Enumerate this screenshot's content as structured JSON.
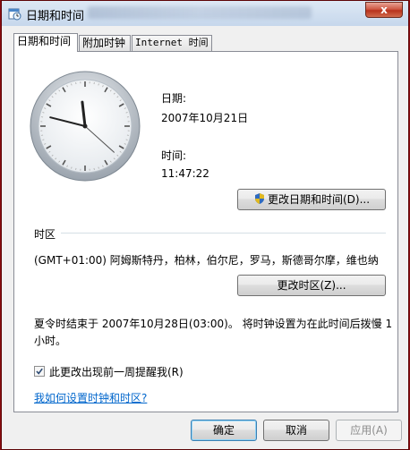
{
  "window": {
    "title": "日期和时间",
    "close_label": "x"
  },
  "tabs": [
    {
      "label": "日期和时间"
    },
    {
      "label": "附加时钟"
    },
    {
      "label": "Internet 时间"
    }
  ],
  "datetime": {
    "date_label": "日期:",
    "date_value": "2007年10月21日",
    "time_label": "时间:",
    "time_value": "11:47:22",
    "change_datetime_button": "更改日期和时间(D)..."
  },
  "clock": {
    "hour": 11,
    "minute": 47,
    "second": 22
  },
  "timezone": {
    "section_label": "时区",
    "value": "(GMT+01:00) 阿姆斯特丹，柏林，伯尔尼，罗马，斯德哥尔摩，维也纳",
    "change_timezone_button": "更改时区(Z)..."
  },
  "dst": {
    "line1": "夏令时结束于 2007年10月28日(03:00)。 将时钟设置为在此时间后拨慢 1",
    "line2": "小时。"
  },
  "reminder": {
    "checked": true,
    "label": "此更改出现前一周提醒我(R)"
  },
  "help_link": "我如何设置时钟和时区?",
  "footer": {
    "ok": "确定",
    "cancel": "取消",
    "apply": "应用(A)"
  }
}
